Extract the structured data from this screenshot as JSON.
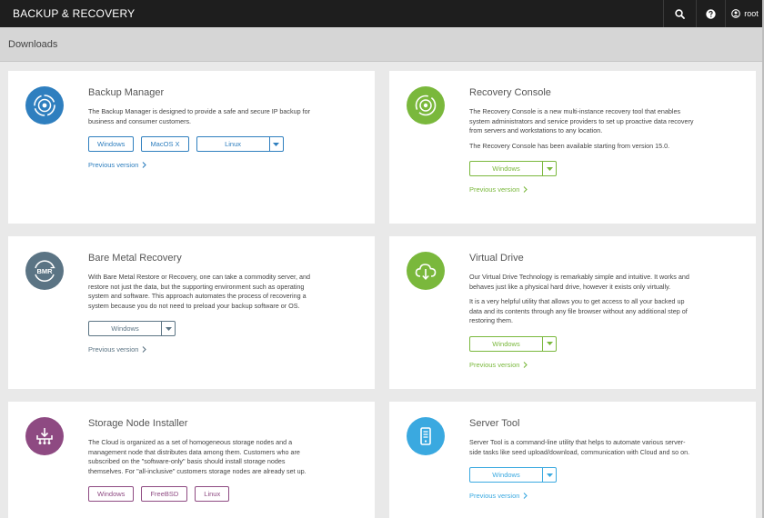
{
  "app": {
    "title": "BACKUP & RECOVERY",
    "user": "root"
  },
  "page": {
    "title": "Downloads"
  },
  "colors": {
    "blue": "#2f7fbf",
    "green": "#7ab83c",
    "slate": "#5b7484",
    "purple": "#8e4a82",
    "cyan": "#3aa9e0"
  },
  "cards": [
    {
      "title": "Backup Manager",
      "icon": "backup-manager-icon",
      "desc": [
        "The Backup Manager is designed to provide a safe and secure IP backup for business and consumer customers."
      ],
      "buttons": [
        "Windows",
        "MacOS X"
      ],
      "split": "Linux",
      "prev": "Previous version"
    },
    {
      "title": "Recovery Console",
      "icon": "recovery-console-icon",
      "desc": [
        "The Recovery Console is a new multi-instance recovery tool that enables system administrators and service providers to set up proactive data recovery from servers and workstations to any location.",
        "The Recovery Console has been available starting from version 15.0."
      ],
      "split": "Windows",
      "prev": "Previous version"
    },
    {
      "title": "Bare Metal Recovery",
      "icon": "bmr-icon",
      "icon_text": "BMR",
      "desc": [
        "With Bare Metal Restore or Recovery, one can take a commodity server, and restore not just the data, but the supporting environment such as operating system and software. This approach automates the process of recovering a system because you do not need to preload your backup software or OS."
      ],
      "split": "Windows",
      "prev": "Previous version"
    },
    {
      "title": "Virtual Drive",
      "icon": "cloud-download-icon",
      "desc": [
        "Our Virtual Drive Technology is remarkably simple and intuitive. It works and behaves just like a physical hard drive, however it exists only virtually.",
        "It is a very helpful utility that allows you to get access to all your backed up data and its contents through any file browser without any additional step of restoring them."
      ],
      "split": "Windows",
      "prev": "Previous version"
    },
    {
      "title": "Storage Node Installer",
      "icon": "storage-node-icon",
      "desc": [
        "The Cloud is organized as a set of homogeneous storage nodes and a management node that distributes data among them. Customers who are subscribed on the \"software-only\" basis should install storage nodes themselves. For \"all-inclusive\" customers storage nodes are already set up."
      ],
      "buttons": [
        "Windows",
        "FreeBSD",
        "Linux"
      ]
    },
    {
      "title": "Server Tool",
      "icon": "server-icon",
      "desc": [
        "Server Tool is a command-line utility that helps to automate various server-side tasks like seed upload/download, communication with Cloud and so on."
      ],
      "split": "Windows",
      "prev": "Previous version"
    }
  ]
}
